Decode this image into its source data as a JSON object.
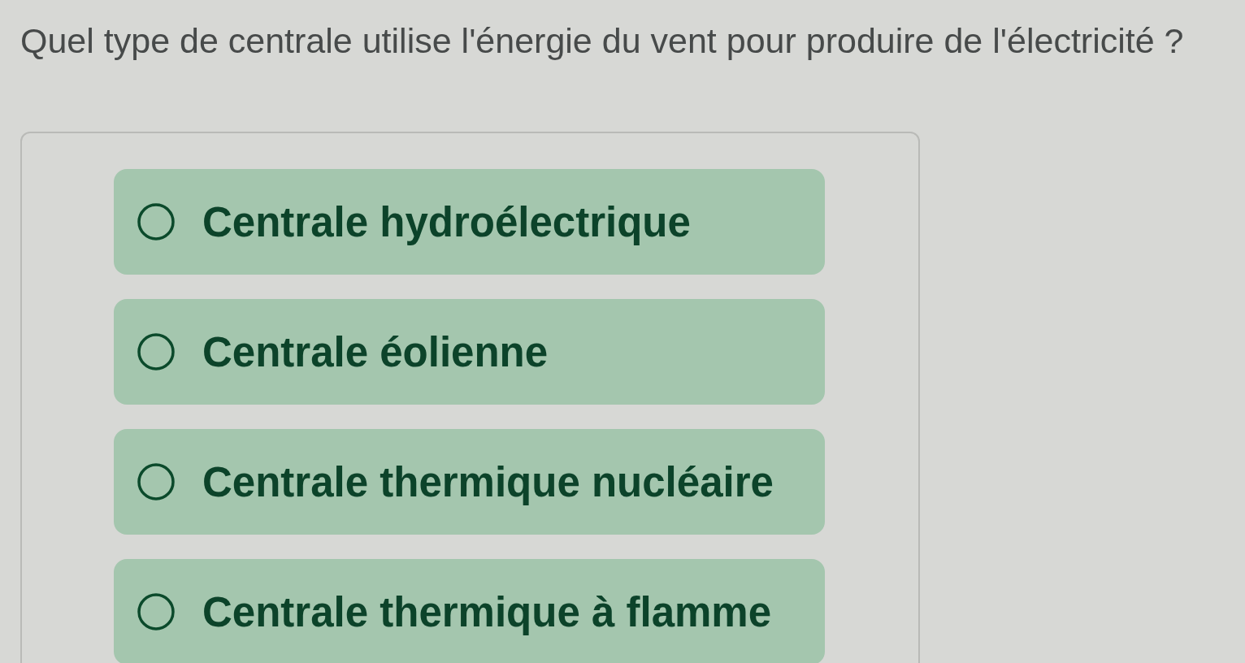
{
  "question": "Quel type de centrale utilise l'énergie du vent pour produire de l'électricité ?",
  "options": [
    {
      "label": "Centrale hydroélectrique",
      "selected": false
    },
    {
      "label": "Centrale éolienne",
      "selected": false
    },
    {
      "label": "Centrale thermique nucléaire",
      "selected": false
    },
    {
      "label": "Centrale thermique à flamme",
      "selected": false
    }
  ]
}
